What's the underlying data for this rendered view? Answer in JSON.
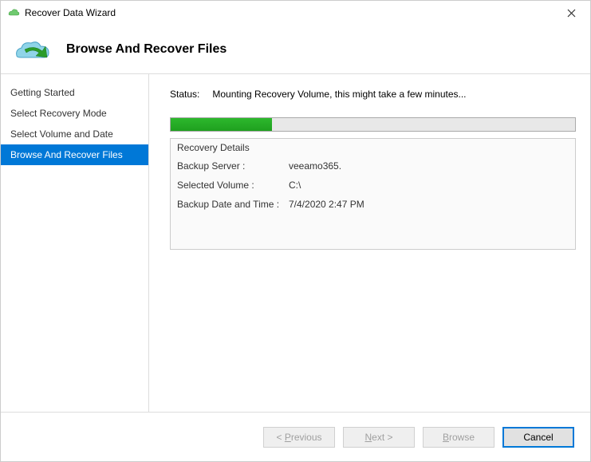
{
  "window": {
    "title": "Recover Data Wizard"
  },
  "header": {
    "title": "Browse And Recover Files"
  },
  "sidebar": {
    "items": [
      {
        "label": "Getting Started",
        "active": false
      },
      {
        "label": "Select Recovery Mode",
        "active": false
      },
      {
        "label": "Select Volume and Date",
        "active": false
      },
      {
        "label": "Browse And Recover Files",
        "active": true
      }
    ]
  },
  "content": {
    "status_label": "Status:",
    "status_text": "Mounting Recovery Volume, this might take a few minutes...",
    "progress_percent": 25,
    "details": {
      "title": "Recovery Details",
      "rows": [
        {
          "key": "Backup Server :",
          "val": "veeamo365."
        },
        {
          "key": "Selected Volume :",
          "val": "C:\\"
        },
        {
          "key": "Backup Date and Time :",
          "val": "7/4/2020 2:47 PM"
        }
      ]
    }
  },
  "footer": {
    "previous": "< Previous",
    "next": "Next >",
    "browse": "Browse",
    "cancel": "Cancel"
  }
}
